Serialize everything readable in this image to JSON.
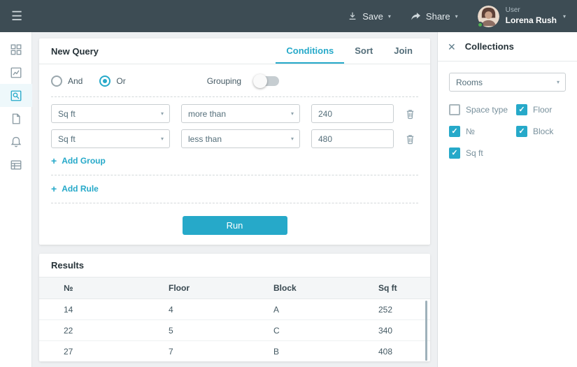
{
  "colors": {
    "accent": "#26a9c9",
    "topbar": "#3d4c54",
    "status_online": "#4caf50"
  },
  "icons": {
    "menu": "☰",
    "chevron_down": "▾",
    "close": "✕",
    "plus": "+",
    "check": "✓"
  },
  "topbar": {
    "save_label": "Save",
    "share_label": "Share",
    "user_label": "User",
    "user_name": "Lorena Rush"
  },
  "sidebar": {
    "items": [
      "dashboard",
      "charts",
      "query-builder",
      "documents",
      "notifications",
      "data-tables"
    ],
    "active": "query-builder"
  },
  "query_card": {
    "title": "New Query",
    "tabs": [
      {
        "label": "Conditions",
        "active": true
      },
      {
        "label": "Sort",
        "active": false
      },
      {
        "label": "Join",
        "active": false
      }
    ],
    "logic": {
      "and_label": "And",
      "or_label": "Or",
      "and_selected": false,
      "or_selected": true,
      "grouping_label": "Grouping",
      "grouping_on": false
    },
    "rules": [
      {
        "field": "Sq ft",
        "operator": "more than",
        "value": "240"
      },
      {
        "field": "Sq ft",
        "operator": "less than",
        "value": "480"
      }
    ],
    "add_group_label": "Add Group",
    "add_rule_label": "Add Rule",
    "run_label": "Run"
  },
  "results_card": {
    "title": "Results",
    "columns": [
      "№",
      "Floor",
      "Block",
      "Sq ft"
    ],
    "rows": [
      [
        "14",
        "4",
        "A",
        "252"
      ],
      [
        "22",
        "5",
        "C",
        "340"
      ],
      [
        "27",
        "7",
        "B",
        "408"
      ]
    ]
  },
  "collections_panel": {
    "title": "Collections",
    "collection_value": "Rooms",
    "fields": [
      {
        "label": "Space type",
        "checked": false
      },
      {
        "label": "Floor",
        "checked": true
      },
      {
        "label": "№",
        "checked": true
      },
      {
        "label": "Block",
        "checked": true
      },
      {
        "label": "Sq ft",
        "checked": true
      }
    ]
  }
}
